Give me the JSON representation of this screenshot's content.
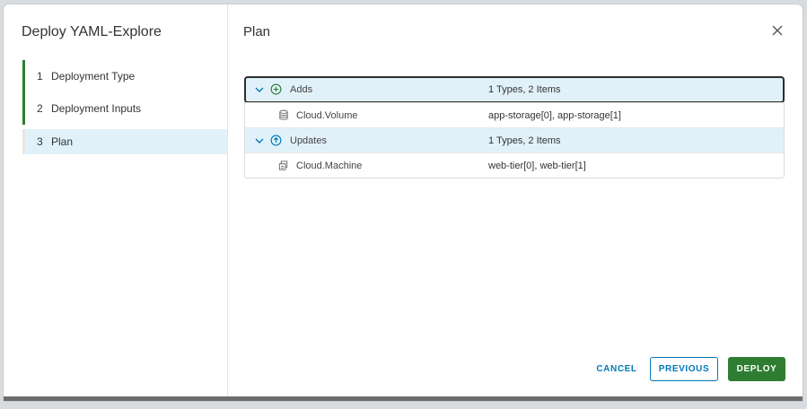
{
  "wizard": {
    "title": "Deploy YAML-Explore",
    "steps": [
      {
        "number": "1",
        "label": "Deployment Type",
        "state": "done"
      },
      {
        "number": "2",
        "label": "Deployment Inputs",
        "state": "done"
      },
      {
        "number": "3",
        "label": "Plan",
        "state": "current"
      }
    ]
  },
  "main": {
    "title": "Plan",
    "close_icon": "close-icon"
  },
  "plan": {
    "groups": [
      {
        "label": "Adds",
        "summary": "1 Types, 2 Items",
        "icon": "plus-circle-icon",
        "icon_color": "#2e7d32",
        "items": [
          {
            "type": "Cloud.Volume",
            "resources": "app-storage[0], app-storage[1]",
            "icon": "database-icon"
          }
        ]
      },
      {
        "label": "Updates",
        "summary": "1 Types, 2 Items",
        "icon": "arrow-up-circle-icon",
        "icon_color": "#0079b8",
        "items": [
          {
            "type": "Cloud.Machine",
            "resources": "web-tier[0], web-tier[1]",
            "icon": "vm-icon"
          }
        ]
      }
    ]
  },
  "footer": {
    "cancel_label": "CANCEL",
    "previous_label": "PREVIOUS",
    "deploy_label": "DEPLOY"
  },
  "colors": {
    "accent_blue": "#0079b8",
    "success_green": "#2e7d32",
    "selected_bg": "#e1f1fa"
  }
}
